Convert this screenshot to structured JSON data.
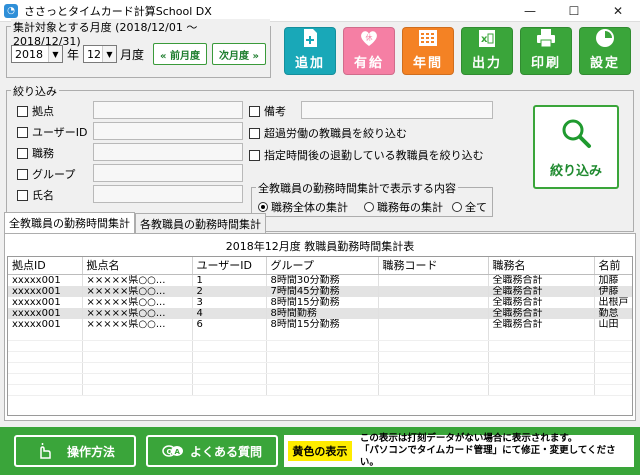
{
  "window": {
    "title": "ささっとタイムカード計算School DX",
    "icon": "app-icon"
  },
  "period": {
    "legend": "集計対象とする月度 (2018/12/01 〜 2018/12/31)",
    "year": "2018",
    "year_unit": "年",
    "month": "12",
    "month_unit": "月度",
    "prev_label": "« 前月度",
    "next_label": "次月度 »"
  },
  "toolbar": [
    {
      "label": "追加",
      "icon": "add-document-icon",
      "color": "#19a8b8"
    },
    {
      "label": "有給",
      "icon": "paid-leave-icon",
      "color": "#f57fa4"
    },
    {
      "label": "年間",
      "icon": "calendar-grid-icon",
      "color": "#f48224"
    },
    {
      "label": "出力",
      "icon": "excel-export-icon",
      "color": "#3aa53a"
    },
    {
      "label": "印刷",
      "icon": "printer-icon",
      "color": "#3aa53a"
    },
    {
      "label": "設定",
      "icon": "settings-icon",
      "color": "#3aa53a"
    }
  ],
  "filter": {
    "legend": "絞り込み",
    "fields": [
      "拠点",
      "ユーザーID",
      "職務",
      "グループ",
      "氏名"
    ],
    "remark": "備考",
    "opt1": "超過労働の教職員を絞り込む",
    "opt2": "指定時間後の退勤している教職員を絞り込む",
    "display": {
      "legend": "全教職員の勤務時間集計で表示する内容",
      "options": [
        "職務全体の集計",
        "職務毎の集計",
        "全て"
      ],
      "selected": 0
    },
    "button": "絞り込み"
  },
  "tabs": [
    "全教職員の勤務時間集計",
    "各教職員の勤務時間集計"
  ],
  "report": {
    "title": "2018年12月度 教職員勤務時間集計表",
    "columns": [
      "拠点ID",
      "拠点名",
      "ユーザーID",
      "グループ",
      "職務コード",
      "職務名",
      "名前"
    ],
    "rows": [
      [
        "xxxxx001",
        "×××××県○○...",
        "1",
        "8時間30分勤務",
        "",
        "全職務合計",
        "加藤"
      ],
      [
        "xxxxx001",
        "×××××県○○...",
        "2",
        "7時間45分勤務",
        "",
        "全職務合計",
        "伊藤"
      ],
      [
        "xxxxx001",
        "×××××県○○...",
        "3",
        "8時間15分勤務",
        "",
        "全職務合計",
        "出根戸"
      ],
      [
        "xxxxx001",
        "×××××県○○...",
        "4",
        "8時間勤務",
        "",
        "全職務合計",
        "勤怠"
      ],
      [
        "xxxxx001",
        "×××××県○○...",
        "6",
        "8時間15分勤務",
        "",
        "全職務合計",
        "山田"
      ]
    ]
  },
  "footer": {
    "manual": "操作方法",
    "faq": "よくある質問",
    "yellow_label": "黄色の表示",
    "note_line1": "この表示は打刻データがない場合に表示されます。",
    "note_line2": "「パソコンでタイムカード管理」にて修正・変更してください。"
  }
}
